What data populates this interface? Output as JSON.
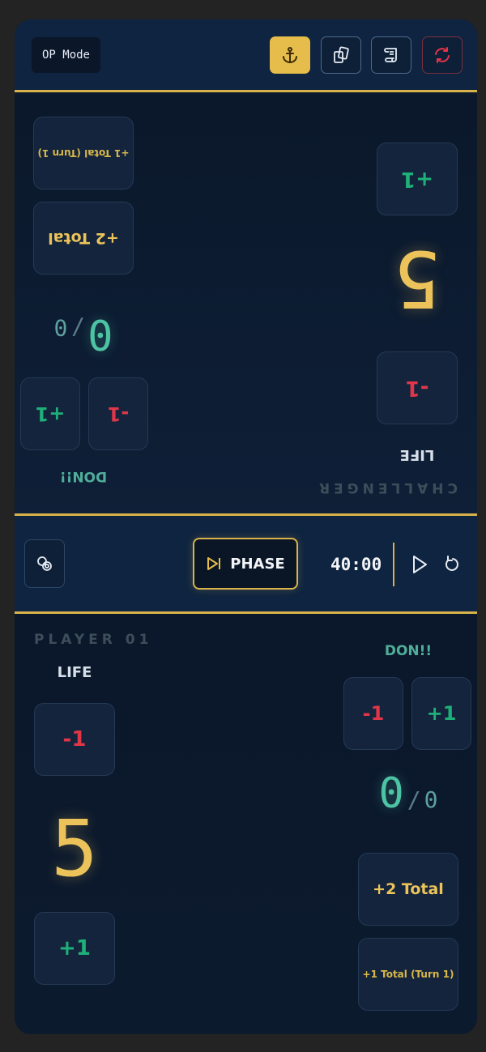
{
  "toolbar": {
    "mode_label": "OP Mode",
    "buttons": [
      {
        "icon": "anchor-icon",
        "active": true
      },
      {
        "icon": "cards-icon",
        "active": false
      },
      {
        "icon": "scroll-icon",
        "active": false
      },
      {
        "icon": "sync-icon",
        "active": false
      }
    ]
  },
  "players": {
    "opponent": {
      "name": "CHALLENGER",
      "life_label": "LIFE",
      "life": "5",
      "life_minus": "-1",
      "life_plus": "+1",
      "don_label": "DON!!",
      "don_minus": "-1",
      "don_plus": "+1",
      "don_current": "0",
      "don_max": "0",
      "don_separator": "/",
      "total2": "+2 Total",
      "total1": "+1 Total (Turn 1)"
    },
    "player": {
      "name": "PLAYER 01",
      "life_label": "LIFE",
      "life": "5",
      "life_minus": "-1",
      "life_plus": "+1",
      "don_label": "DON!!",
      "don_minus": "-1",
      "don_plus": "+1",
      "don_current": "0",
      "don_max": "0",
      "don_separator": "/",
      "total2": "+2 Total",
      "total1": "+1 Total (Turn 1)"
    }
  },
  "midbar": {
    "phase_label": "PHASE",
    "timer": "40:00"
  },
  "colors": {
    "accent": "#d8b24a",
    "life": "#ebc35a",
    "minus": "#e0364a",
    "plus": "#1fb07a",
    "don": "#4ec3a4"
  }
}
